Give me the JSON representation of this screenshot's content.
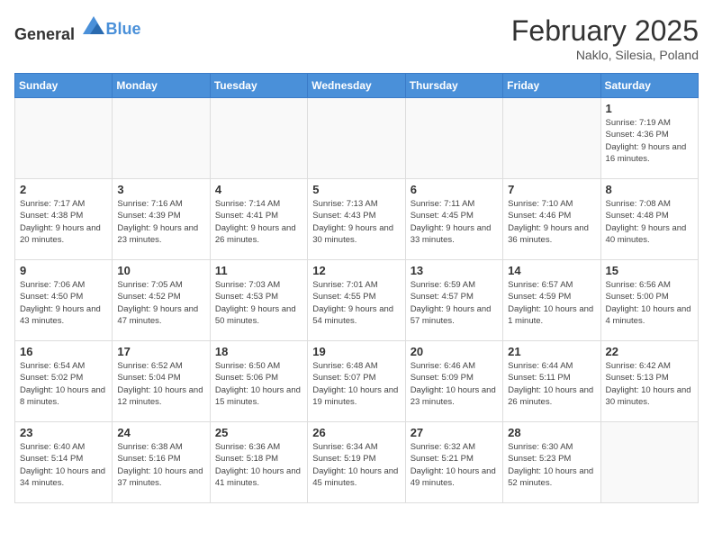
{
  "header": {
    "logo_general": "General",
    "logo_blue": "Blue",
    "month": "February 2025",
    "location": "Naklo, Silesia, Poland"
  },
  "days_of_week": [
    "Sunday",
    "Monday",
    "Tuesday",
    "Wednesday",
    "Thursday",
    "Friday",
    "Saturday"
  ],
  "weeks": [
    [
      {
        "day": "",
        "info": ""
      },
      {
        "day": "",
        "info": ""
      },
      {
        "day": "",
        "info": ""
      },
      {
        "day": "",
        "info": ""
      },
      {
        "day": "",
        "info": ""
      },
      {
        "day": "",
        "info": ""
      },
      {
        "day": "1",
        "info": "Sunrise: 7:19 AM\nSunset: 4:36 PM\nDaylight: 9 hours and 16 minutes."
      }
    ],
    [
      {
        "day": "2",
        "info": "Sunrise: 7:17 AM\nSunset: 4:38 PM\nDaylight: 9 hours and 20 minutes."
      },
      {
        "day": "3",
        "info": "Sunrise: 7:16 AM\nSunset: 4:39 PM\nDaylight: 9 hours and 23 minutes."
      },
      {
        "day": "4",
        "info": "Sunrise: 7:14 AM\nSunset: 4:41 PM\nDaylight: 9 hours and 26 minutes."
      },
      {
        "day": "5",
        "info": "Sunrise: 7:13 AM\nSunset: 4:43 PM\nDaylight: 9 hours and 30 minutes."
      },
      {
        "day": "6",
        "info": "Sunrise: 7:11 AM\nSunset: 4:45 PM\nDaylight: 9 hours and 33 minutes."
      },
      {
        "day": "7",
        "info": "Sunrise: 7:10 AM\nSunset: 4:46 PM\nDaylight: 9 hours and 36 minutes."
      },
      {
        "day": "8",
        "info": "Sunrise: 7:08 AM\nSunset: 4:48 PM\nDaylight: 9 hours and 40 minutes."
      }
    ],
    [
      {
        "day": "9",
        "info": "Sunrise: 7:06 AM\nSunset: 4:50 PM\nDaylight: 9 hours and 43 minutes."
      },
      {
        "day": "10",
        "info": "Sunrise: 7:05 AM\nSunset: 4:52 PM\nDaylight: 9 hours and 47 minutes."
      },
      {
        "day": "11",
        "info": "Sunrise: 7:03 AM\nSunset: 4:53 PM\nDaylight: 9 hours and 50 minutes."
      },
      {
        "day": "12",
        "info": "Sunrise: 7:01 AM\nSunset: 4:55 PM\nDaylight: 9 hours and 54 minutes."
      },
      {
        "day": "13",
        "info": "Sunrise: 6:59 AM\nSunset: 4:57 PM\nDaylight: 9 hours and 57 minutes."
      },
      {
        "day": "14",
        "info": "Sunrise: 6:57 AM\nSunset: 4:59 PM\nDaylight: 10 hours and 1 minute."
      },
      {
        "day": "15",
        "info": "Sunrise: 6:56 AM\nSunset: 5:00 PM\nDaylight: 10 hours and 4 minutes."
      }
    ],
    [
      {
        "day": "16",
        "info": "Sunrise: 6:54 AM\nSunset: 5:02 PM\nDaylight: 10 hours and 8 minutes."
      },
      {
        "day": "17",
        "info": "Sunrise: 6:52 AM\nSunset: 5:04 PM\nDaylight: 10 hours and 12 minutes."
      },
      {
        "day": "18",
        "info": "Sunrise: 6:50 AM\nSunset: 5:06 PM\nDaylight: 10 hours and 15 minutes."
      },
      {
        "day": "19",
        "info": "Sunrise: 6:48 AM\nSunset: 5:07 PM\nDaylight: 10 hours and 19 minutes."
      },
      {
        "day": "20",
        "info": "Sunrise: 6:46 AM\nSunset: 5:09 PM\nDaylight: 10 hours and 23 minutes."
      },
      {
        "day": "21",
        "info": "Sunrise: 6:44 AM\nSunset: 5:11 PM\nDaylight: 10 hours and 26 minutes."
      },
      {
        "day": "22",
        "info": "Sunrise: 6:42 AM\nSunset: 5:13 PM\nDaylight: 10 hours and 30 minutes."
      }
    ],
    [
      {
        "day": "23",
        "info": "Sunrise: 6:40 AM\nSunset: 5:14 PM\nDaylight: 10 hours and 34 minutes."
      },
      {
        "day": "24",
        "info": "Sunrise: 6:38 AM\nSunset: 5:16 PM\nDaylight: 10 hours and 37 minutes."
      },
      {
        "day": "25",
        "info": "Sunrise: 6:36 AM\nSunset: 5:18 PM\nDaylight: 10 hours and 41 minutes."
      },
      {
        "day": "26",
        "info": "Sunrise: 6:34 AM\nSunset: 5:19 PM\nDaylight: 10 hours and 45 minutes."
      },
      {
        "day": "27",
        "info": "Sunrise: 6:32 AM\nSunset: 5:21 PM\nDaylight: 10 hours and 49 minutes."
      },
      {
        "day": "28",
        "info": "Sunrise: 6:30 AM\nSunset: 5:23 PM\nDaylight: 10 hours and 52 minutes."
      },
      {
        "day": "",
        "info": ""
      }
    ]
  ]
}
